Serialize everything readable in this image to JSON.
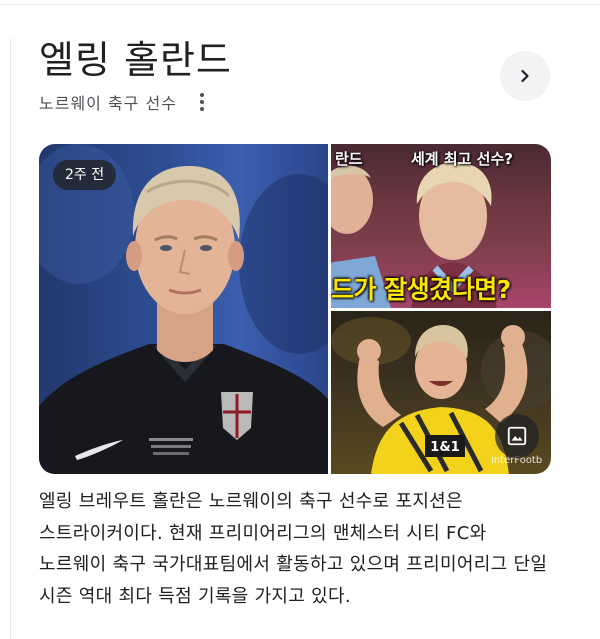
{
  "entity": {
    "title": "엘링 홀란드",
    "subtitle": "노르웨이 축구 선수",
    "description": "엘링 브레우트 홀란은 노르웨이의 축구 선수로 포지션은 스트라이커이다. 현재 프리미어리그의 맨체스터 시티 FC와 노르웨이 축구 국가대표팀에서 활동하고 있으며 프리미어리그 단일 시즌 역대 최다 득점 기록을 가지고 있다."
  },
  "icons": {
    "more": "more-vert-icon",
    "next": "chevron-right-icon",
    "gallery": "image-icon"
  },
  "gallery": {
    "main": {
      "badge": "2주 전"
    },
    "top_right": {
      "overlay_left": "란드",
      "overlay_right": "세계 최고 선수?",
      "overlay_bottom": "드가 잘생겼다면?"
    },
    "bottom_right": {
      "jersey_sponsor": "1&1",
      "watermark": "interFootb"
    }
  },
  "colors": {
    "text_primary": "#202124",
    "text_secondary": "#4d5156",
    "button_bg": "#f1f3f4",
    "overlay_yellow": "#ffe600"
  }
}
